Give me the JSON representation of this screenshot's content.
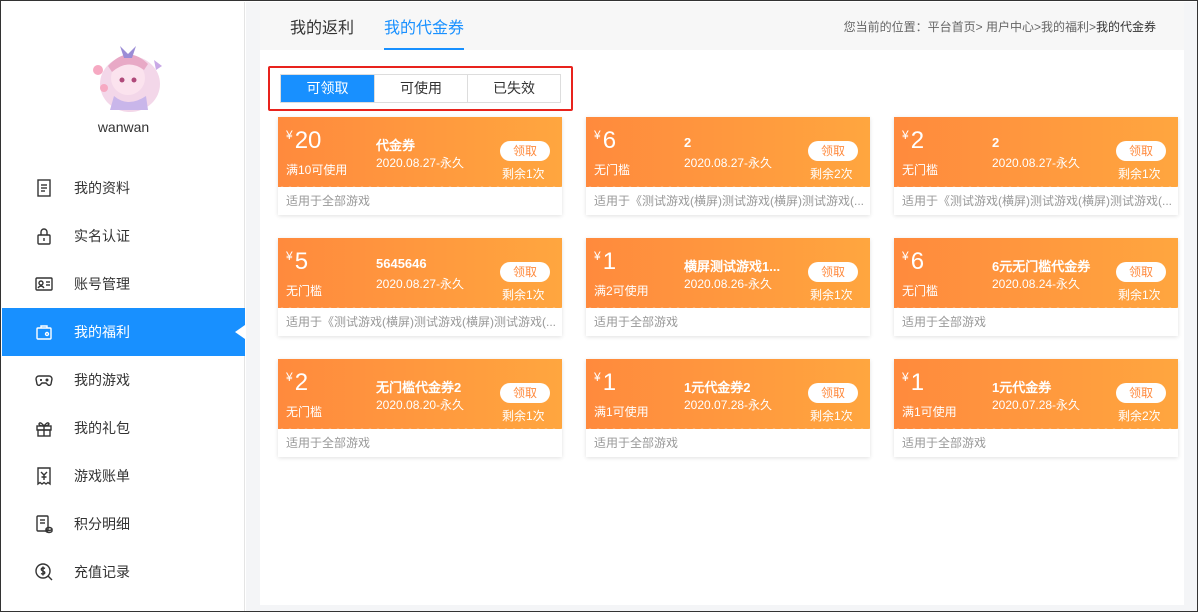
{
  "sidebar": {
    "username": "wanwan",
    "items": [
      {
        "label": "我的资料",
        "icon": "document-icon"
      },
      {
        "label": "实名认证",
        "icon": "lock-icon"
      },
      {
        "label": "账号管理",
        "icon": "id-card-icon"
      },
      {
        "label": "我的福利",
        "icon": "gift-bag-icon",
        "active": true
      },
      {
        "label": "我的游戏",
        "icon": "gamepad-icon"
      },
      {
        "label": "我的礼包",
        "icon": "gift-icon"
      },
      {
        "label": "游戏账单",
        "icon": "bill-icon"
      },
      {
        "label": "积分明细",
        "icon": "points-icon"
      },
      {
        "label": "充值记录",
        "icon": "dollar-icon"
      }
    ]
  },
  "header": {
    "tabs": [
      "我的返利",
      "我的代金券"
    ],
    "active_tab": "我的代金券",
    "breadcrumb_prefix": "您当前的位置：平台首页> 用户中心>我的福利>",
    "breadcrumb_current": "我的代金券"
  },
  "subtabs": [
    "可领取",
    "可使用",
    "已失效"
  ],
  "active_subtab": "可领取",
  "colors": {
    "accent": "#1890ff",
    "coupon": "#ff8a3d",
    "highlight_box": "#e8231d"
  },
  "currency_symbol": "¥",
  "claim_label": "领取",
  "coupons": [
    {
      "amount": "20",
      "threshold": "满10可使用",
      "name": "代金券",
      "date": "2020.08.27-永久",
      "remain": "剩余1次",
      "scope": "适用于全部游戏"
    },
    {
      "amount": "6",
      "threshold": "无门槛",
      "name": "2",
      "date": "2020.08.27-永久",
      "remain": "剩余2次",
      "scope": "适用于《测试游戏(横屏)测试游戏(横屏)测试游戏(..."
    },
    {
      "amount": "2",
      "threshold": "无门槛",
      "name": "2",
      "date": "2020.08.27-永久",
      "remain": "剩余1次",
      "scope": "适用于《测试游戏(横屏)测试游戏(横屏)测试游戏(..."
    },
    {
      "amount": "5",
      "threshold": "无门槛",
      "name": "5645646",
      "date": "2020.08.27-永久",
      "remain": "剩余1次",
      "scope": "适用于《测试游戏(横屏)测试游戏(横屏)测试游戏(..."
    },
    {
      "amount": "1",
      "threshold": "满2可使用",
      "name": "横屏测试游戏1...",
      "date": "2020.08.26-永久",
      "remain": "剩余1次",
      "scope": "适用于全部游戏"
    },
    {
      "amount": "6",
      "threshold": "无门槛",
      "name": "6元无门槛代金券",
      "date": "2020.08.24-永久",
      "remain": "剩余1次",
      "scope": "适用于全部游戏"
    },
    {
      "amount": "2",
      "threshold": "无门槛",
      "name": "无门槛代金券2",
      "date": "2020.08.20-永久",
      "remain": "剩余1次",
      "scope": "适用于全部游戏"
    },
    {
      "amount": "1",
      "threshold": "满1可使用",
      "name": "1元代金券2",
      "date": "2020.07.28-永久",
      "remain": "剩余1次",
      "scope": "适用于全部游戏"
    },
    {
      "amount": "1",
      "threshold": "满1可使用",
      "name": "1元代金券",
      "date": "2020.07.28-永久",
      "remain": "剩余2次",
      "scope": "适用于全部游戏"
    }
  ]
}
